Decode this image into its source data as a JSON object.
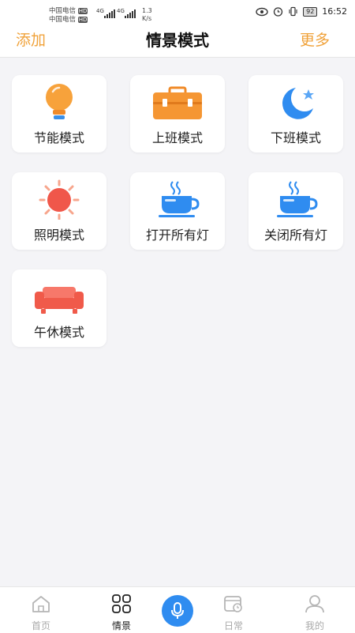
{
  "status_bar": {
    "carrier_1": "中国电信",
    "carrier_2": "中国电信",
    "hd_tag": "HD",
    "net_tag_1": "4G",
    "net_tag_2": "4G",
    "speed_value": "1.3",
    "speed_unit": "K/s",
    "battery": "92",
    "time": "16:52"
  },
  "header": {
    "left_action": "添加",
    "title": "情景模式",
    "right_action": "更多",
    "accent_color": "#f0a23a"
  },
  "scenes": [
    {
      "label": "节能模式",
      "icon": "lightbulb-icon"
    },
    {
      "label": "上班模式",
      "icon": "briefcase-icon"
    },
    {
      "label": "下班模式",
      "icon": "moon-star-icon"
    },
    {
      "label": "照明模式",
      "icon": "sun-icon"
    },
    {
      "label": "打开所有灯",
      "icon": "coffee-cup-icon"
    },
    {
      "label": "关闭所有灯",
      "icon": "coffee-cup-icon"
    },
    {
      "label": "午休模式",
      "icon": "sofa-icon"
    }
  ],
  "bottom_nav": {
    "items": [
      {
        "label": "首页",
        "icon": "home-icon",
        "active": false
      },
      {
        "label": "情景",
        "icon": "grid-icon",
        "active": true
      },
      {
        "label": "",
        "icon": "microphone-icon",
        "active": false
      },
      {
        "label": "日常",
        "icon": "calendar-clock-icon",
        "active": false
      },
      {
        "label": "我的",
        "icon": "user-icon",
        "active": false
      }
    ],
    "mic_color": "#2f8cf0"
  }
}
